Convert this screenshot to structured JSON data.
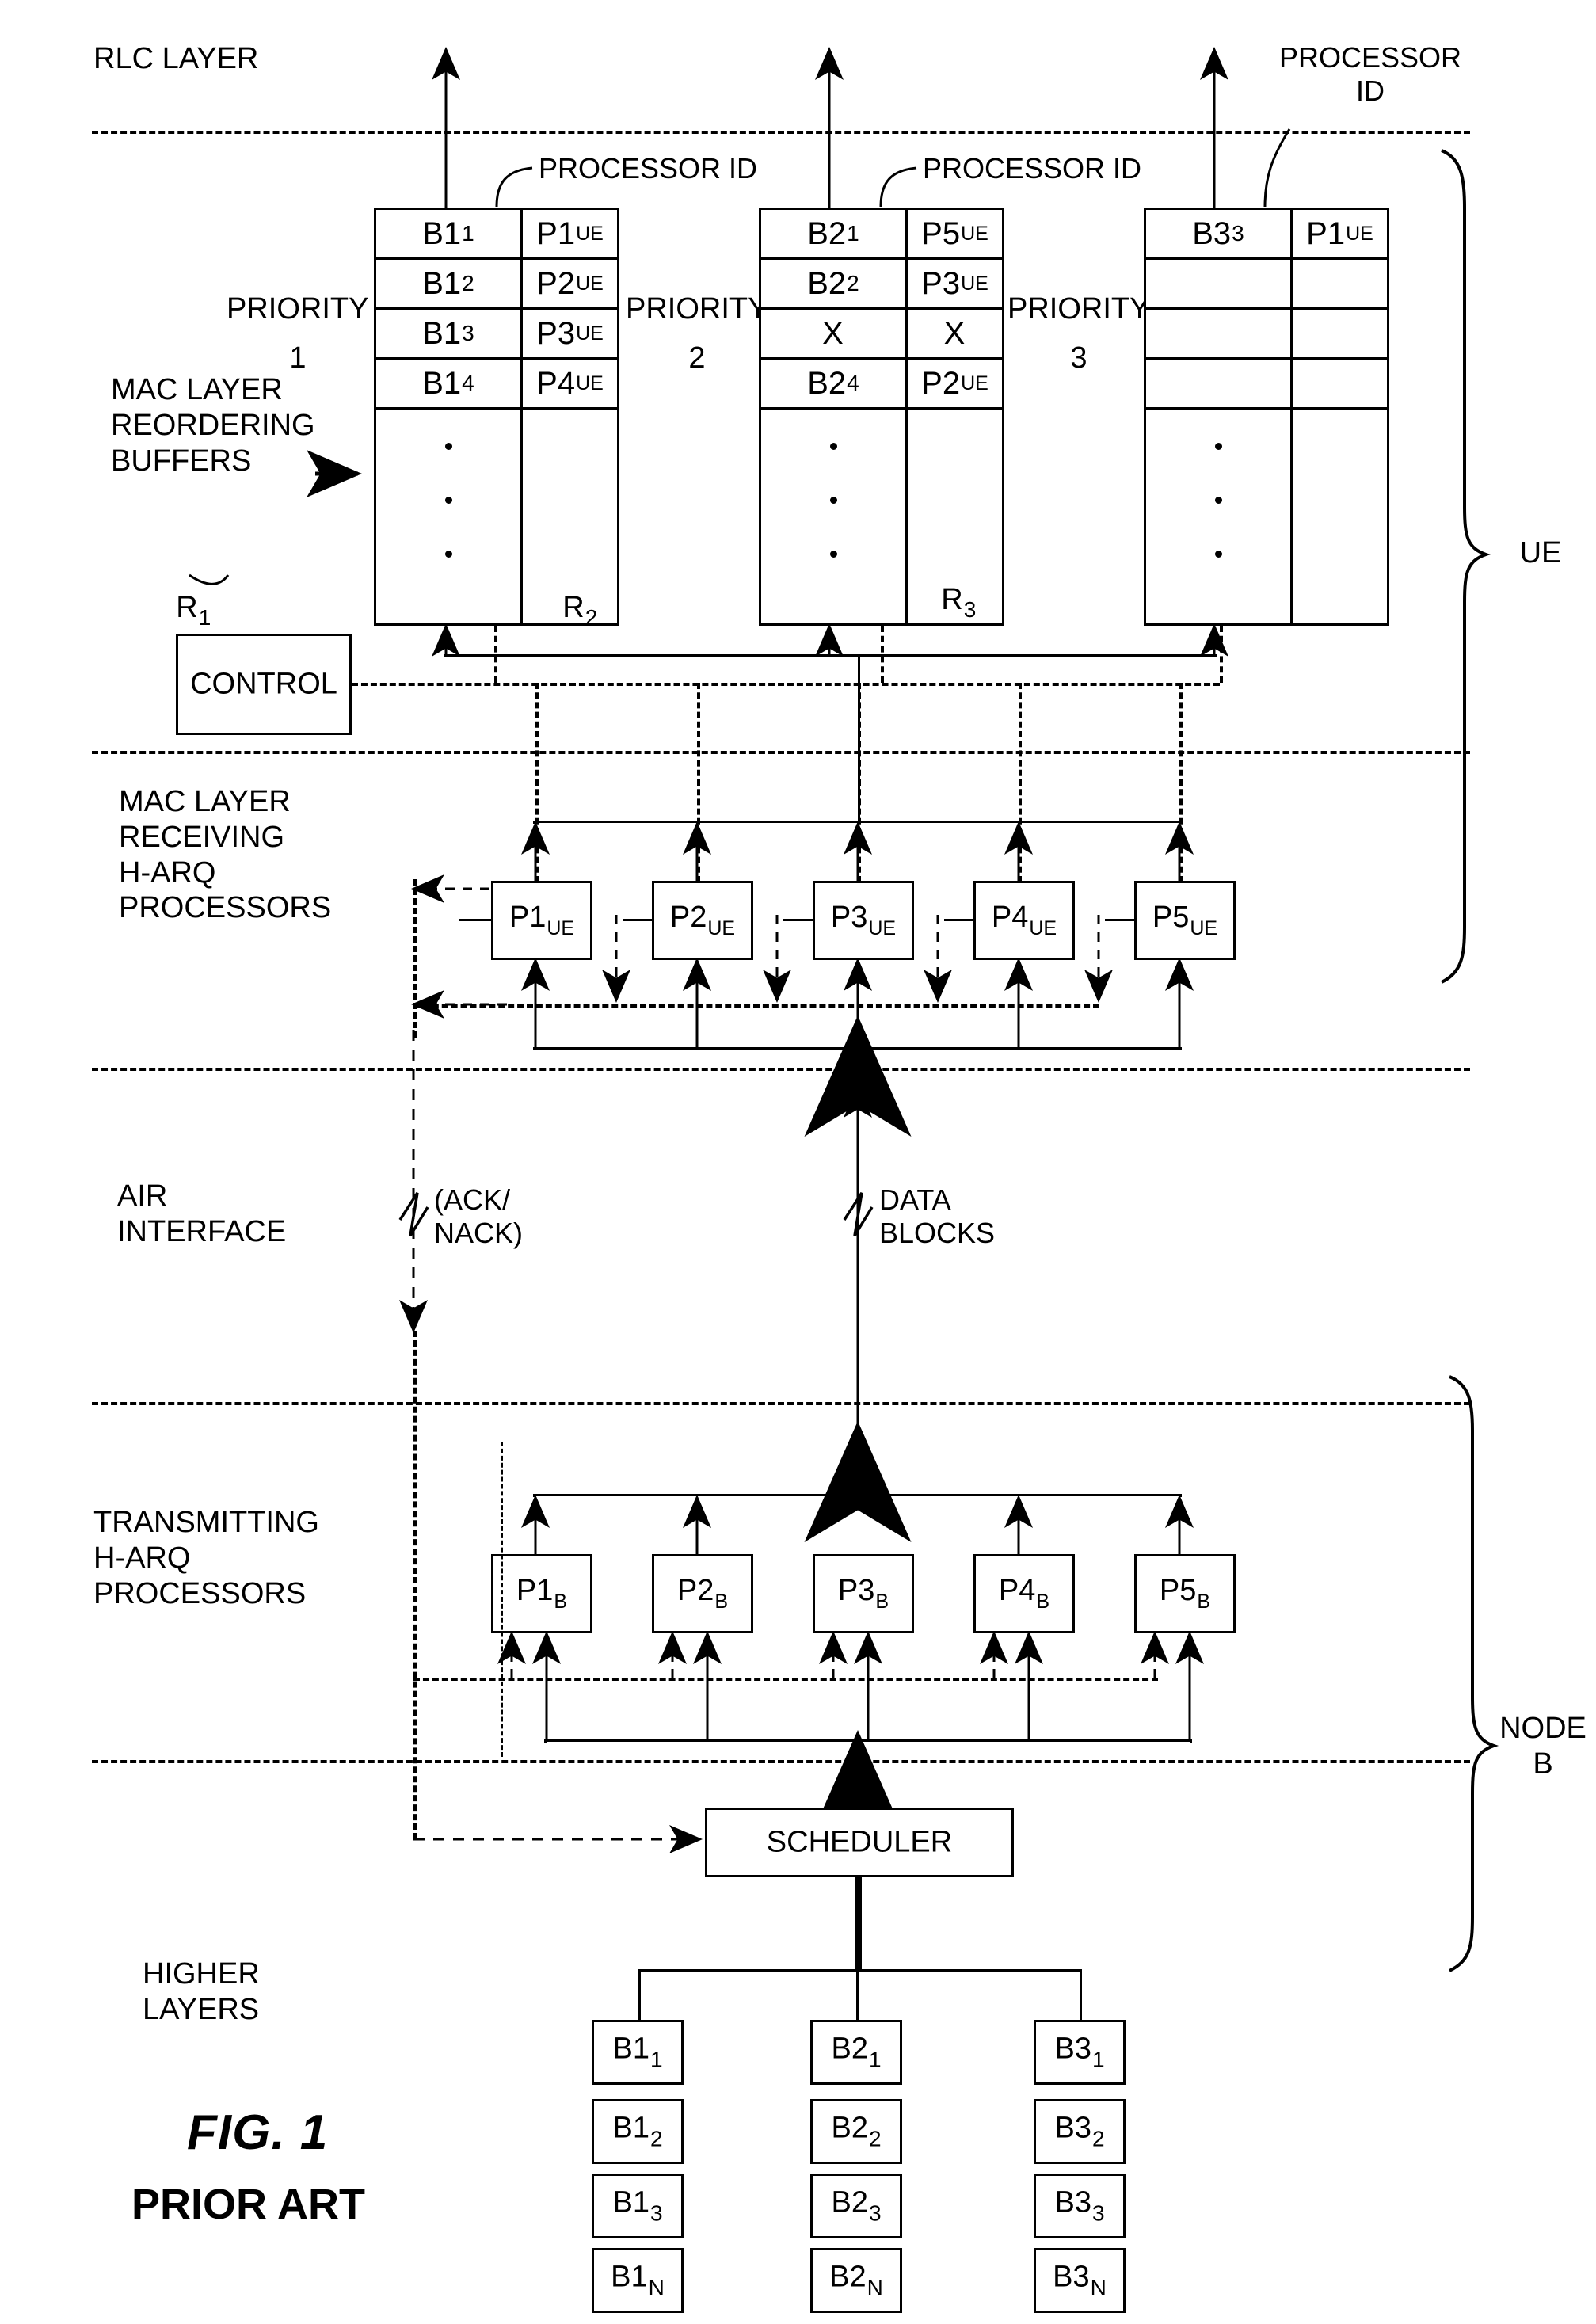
{
  "figure": {
    "caption": "FIG. 1",
    "subcaption": "PRIOR ART"
  },
  "layer_labels": {
    "rlc_layer": "RLC LAYER",
    "mac_reordering": "MAC LAYER\nREORDERING\nBUFFERS",
    "mac_receiving": "MAC LAYER\nRECEIVING\nH-ARQ\nPROCESSORS",
    "air_interface": "AIR\nINTERFACE",
    "transmitting": "TRANSMITTING\nH-ARQ\nPROCESSORS",
    "higher_layers": "HIGHER\nLAYERS"
  },
  "side_braces": {
    "ue": "UE",
    "node_b": "NODE\nB"
  },
  "callouts": {
    "processor_id_1": "PROCESSOR ID",
    "processor_id_2": "PROCESSOR ID",
    "processor_id_3": "PROCESSOR\nID"
  },
  "reordering_buffers": {
    "priority_word": "PRIORITY",
    "columns": [
      {
        "priority_label": "PRIORITY",
        "priority_number": "1",
        "ref": "R",
        "ref_sub": "1",
        "rows": [
          {
            "block": "B1",
            "block_sub": "1",
            "proc": "P1",
            "proc_sub": "UE"
          },
          {
            "block": "B1",
            "block_sub": "2",
            "proc": "P2",
            "proc_sub": "UE"
          },
          {
            "block": "B1",
            "block_sub": "3",
            "proc": "P3",
            "proc_sub": "UE"
          },
          {
            "block": "B1",
            "block_sub": "4",
            "proc": "P4",
            "proc_sub": "UE"
          }
        ]
      },
      {
        "priority_label": "PRIORITY",
        "priority_number": "2",
        "ref": "R",
        "ref_sub": "2",
        "rows": [
          {
            "block": "B2",
            "block_sub": "1",
            "proc": "P5",
            "proc_sub": "UE"
          },
          {
            "block": "B2",
            "block_sub": "2",
            "proc": "P3",
            "proc_sub": "UE"
          },
          {
            "block": "X",
            "block_sub": "",
            "proc": "X",
            "proc_sub": ""
          },
          {
            "block": "B2",
            "block_sub": "4",
            "proc": "P2",
            "proc_sub": "UE"
          }
        ]
      },
      {
        "priority_label": "PRIORITY",
        "priority_number": "3",
        "ref": "R",
        "ref_sub": "3",
        "rows": [
          {
            "block": "B3",
            "block_sub": "3",
            "proc": "P1",
            "proc_sub": "UE"
          },
          {
            "block": "",
            "block_sub": "",
            "proc": "",
            "proc_sub": ""
          },
          {
            "block": "",
            "block_sub": "",
            "proc": "",
            "proc_sub": ""
          },
          {
            "block": "",
            "block_sub": "",
            "proc": "",
            "proc_sub": ""
          }
        ]
      }
    ]
  },
  "control_box": {
    "label": "CONTROL"
  },
  "receiving_processors": [
    {
      "name": "P1",
      "sub": "UE"
    },
    {
      "name": "P2",
      "sub": "UE"
    },
    {
      "name": "P3",
      "sub": "UE"
    },
    {
      "name": "P4",
      "sub": "UE"
    },
    {
      "name": "P5",
      "sub": "UE"
    }
  ],
  "air_interface_links": {
    "ack_nack": "(ACK/\nNACK)",
    "data_blocks": "DATA\nBLOCKS"
  },
  "transmitting_processors": [
    {
      "name": "P1",
      "sub": "B"
    },
    {
      "name": "P2",
      "sub": "B"
    },
    {
      "name": "P3",
      "sub": "B"
    },
    {
      "name": "P4",
      "sub": "B"
    },
    {
      "name": "P5",
      "sub": "B"
    }
  ],
  "scheduler_box": {
    "label": "SCHEDULER"
  },
  "higher_layer_queues": [
    {
      "blocks": [
        {
          "name": "B1",
          "sub": "1"
        },
        {
          "name": "B1",
          "sub": "2"
        },
        {
          "name": "B1",
          "sub": "3"
        },
        {
          "name": "B1",
          "sub": "N"
        }
      ]
    },
    {
      "blocks": [
        {
          "name": "B2",
          "sub": "1"
        },
        {
          "name": "B2",
          "sub": "2"
        },
        {
          "name": "B2",
          "sub": "3"
        },
        {
          "name": "B2",
          "sub": "N"
        }
      ]
    },
    {
      "blocks": [
        {
          "name": "B3",
          "sub": "1"
        },
        {
          "name": "B3",
          "sub": "2"
        },
        {
          "name": "B3",
          "sub": "3"
        },
        {
          "name": "B3",
          "sub": "N"
        }
      ]
    }
  ],
  "colors": {
    "ink": "#000000",
    "paper": "#ffffff"
  }
}
